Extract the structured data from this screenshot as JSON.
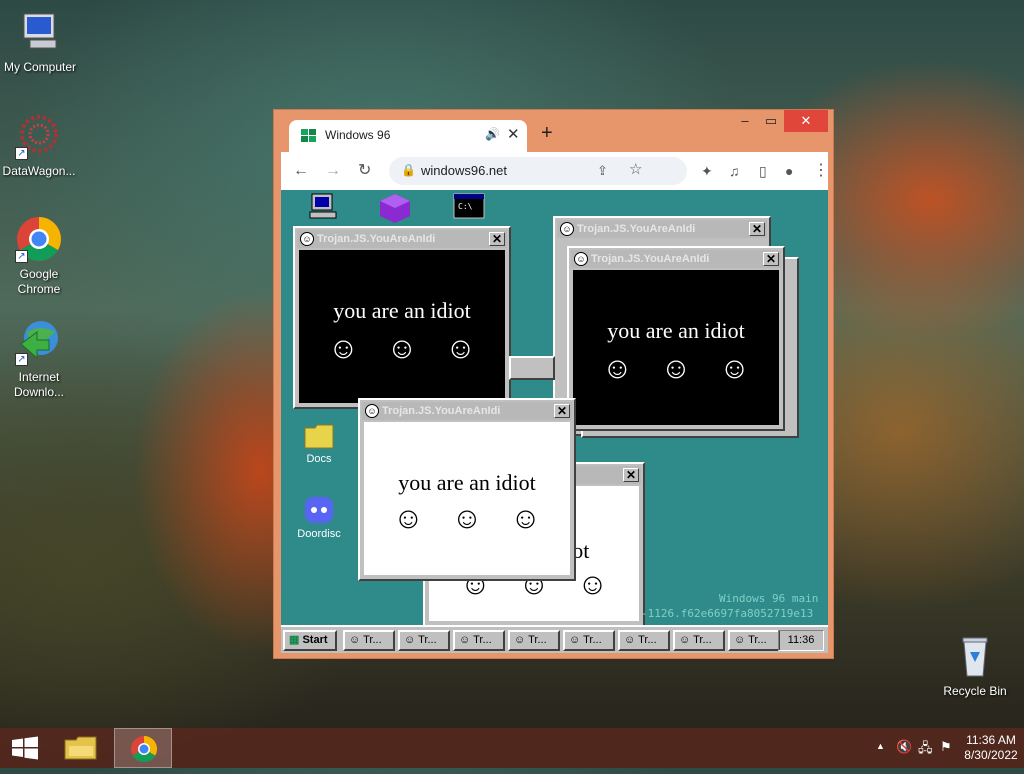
{
  "desktop": {
    "icons": [
      {
        "label": "My Computer"
      },
      {
        "label": "DataWagon..."
      },
      {
        "label": "Google Chrome"
      },
      {
        "label": "Internet Downlo..."
      },
      {
        "label": "Recycle Bin"
      }
    ]
  },
  "browser": {
    "tab_title": "Windows 96",
    "url": "windows96.net",
    "new_tab": "+",
    "window_controls": {
      "minimize": "–",
      "maximize": "▭",
      "close": "✕"
    }
  },
  "win96": {
    "icons": [
      {
        "label": "Docs"
      },
      {
        "label": "Doordisc"
      }
    ],
    "popup_title": "Trojan.JS.YouAreAnIdi",
    "popup_message": "you are an idiot",
    "partial_message": "idiot",
    "start_label": "Start",
    "task_label": "Tr...",
    "clock": "11:36",
    "watermark_line1": "Windows 96 main",
    "watermark_line2": "-1126.f62e6697fa8052719e13"
  },
  "taskbar": {
    "time": "11:36 AM",
    "date": "8/30/2022"
  }
}
